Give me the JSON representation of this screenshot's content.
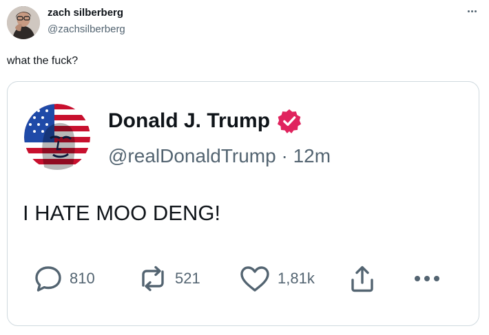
{
  "outer_post": {
    "author_name": "zach silberberg",
    "author_handle": "@zachsilberberg",
    "text": "what the fuck?",
    "more_icon": "more-horizontal-icon"
  },
  "quoted_post": {
    "author_name": "Donald J. Trump",
    "verified_icon": "verified-badge-icon",
    "verified_color": "#e0245e",
    "author_handle": "@realDonaldTrump",
    "separator": "·",
    "timestamp": "12m",
    "text": "I HATE MOO DENG!",
    "actions": {
      "replies": "810",
      "reposts": "521",
      "likes": "1,81k"
    },
    "action_icons": [
      "reply-icon",
      "repost-icon",
      "like-icon",
      "share-icon",
      "more-horizontal-icon"
    ]
  },
  "colors": {
    "text_primary": "#0f1419",
    "text_secondary": "#536471",
    "border": "#cfd9de"
  }
}
